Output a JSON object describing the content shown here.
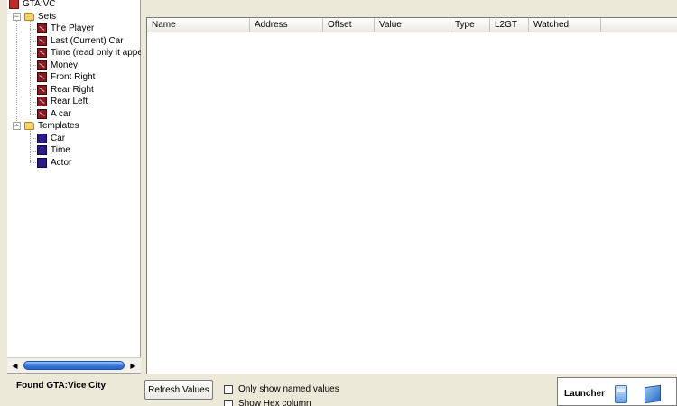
{
  "tree": {
    "root": "GTA:VC",
    "sets_folder": "Sets",
    "sets": [
      "The Player",
      "Last (Current) Car",
      "Time (read only it appea",
      "Money",
      "Front Right",
      "Rear Right",
      "Rear Left",
      "A car"
    ],
    "templates_folder": "Templates",
    "templates": [
      "Car",
      "Time",
      "Actor"
    ]
  },
  "list": {
    "columns": [
      "Name",
      "Address",
      "Offset",
      "Value",
      "Type",
      "L2GT",
      "Watched"
    ]
  },
  "footer": {
    "status": "Found GTA:Vice City",
    "refresh_label": "Refresh Values",
    "only_named_label": "Only show named values",
    "show_hex_label": "Show Hex column",
    "launcher_label": "Launcher"
  },
  "icons": {
    "set_item": "set-icon",
    "template_item": "template-icon",
    "folder": "folder-icon",
    "launcher_1": "phone-icon",
    "launcher_2": "book-icon"
  }
}
